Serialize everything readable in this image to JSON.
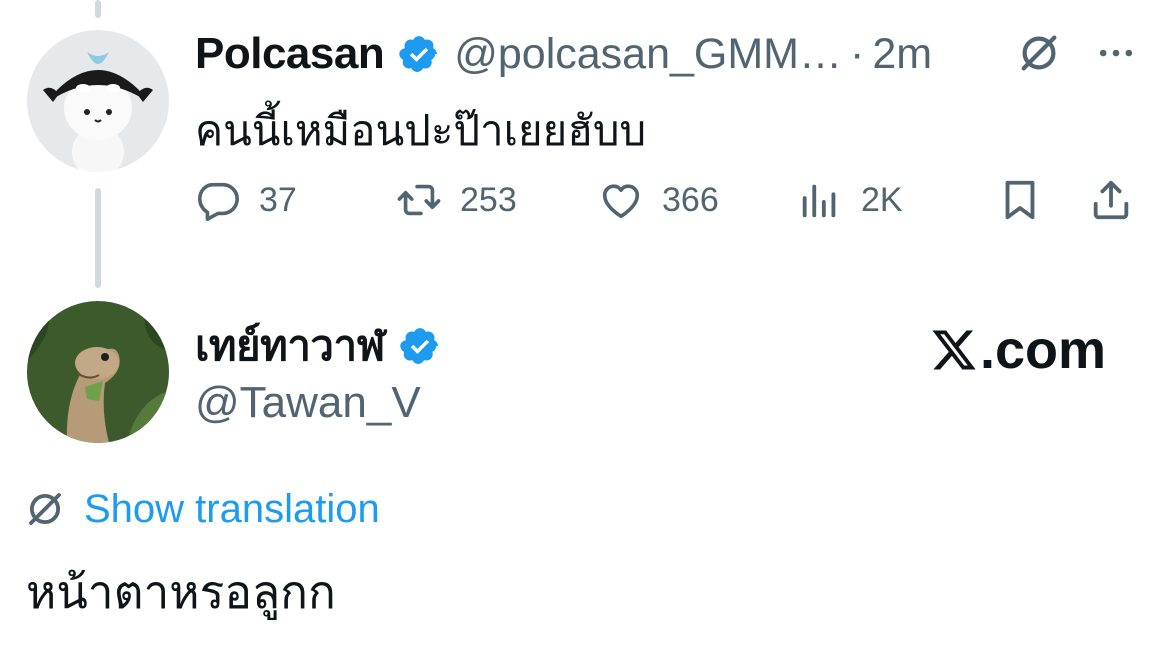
{
  "parent_tweet": {
    "author_name": "Polcasan",
    "verified": true,
    "handle": "@polcasan_GMM…",
    "separator": "·",
    "time": "2m",
    "text": "คนนี้เหมือนปะป๊าเยยฮับบ",
    "header_icons": [
      "translate-icon",
      "more-icon"
    ],
    "actions": {
      "reply_count": "37",
      "repost_count": "253",
      "like_count": "366",
      "views_count": "2K"
    }
  },
  "reply_tweet": {
    "author_name": "เทย์ทาวาฬ",
    "verified": true,
    "handle": "@Tawan_V",
    "show_translation_label": "Show translation",
    "text": "หน้าตาหรอลูกก"
  },
  "brand": {
    "label": ".com"
  },
  "colors": {
    "accent": "#1d9bf0",
    "verified_badge": "#1d9bf0",
    "secondary_text": "#536471",
    "primary_text": "#0f1419",
    "thread_line": "#cfd9de"
  }
}
